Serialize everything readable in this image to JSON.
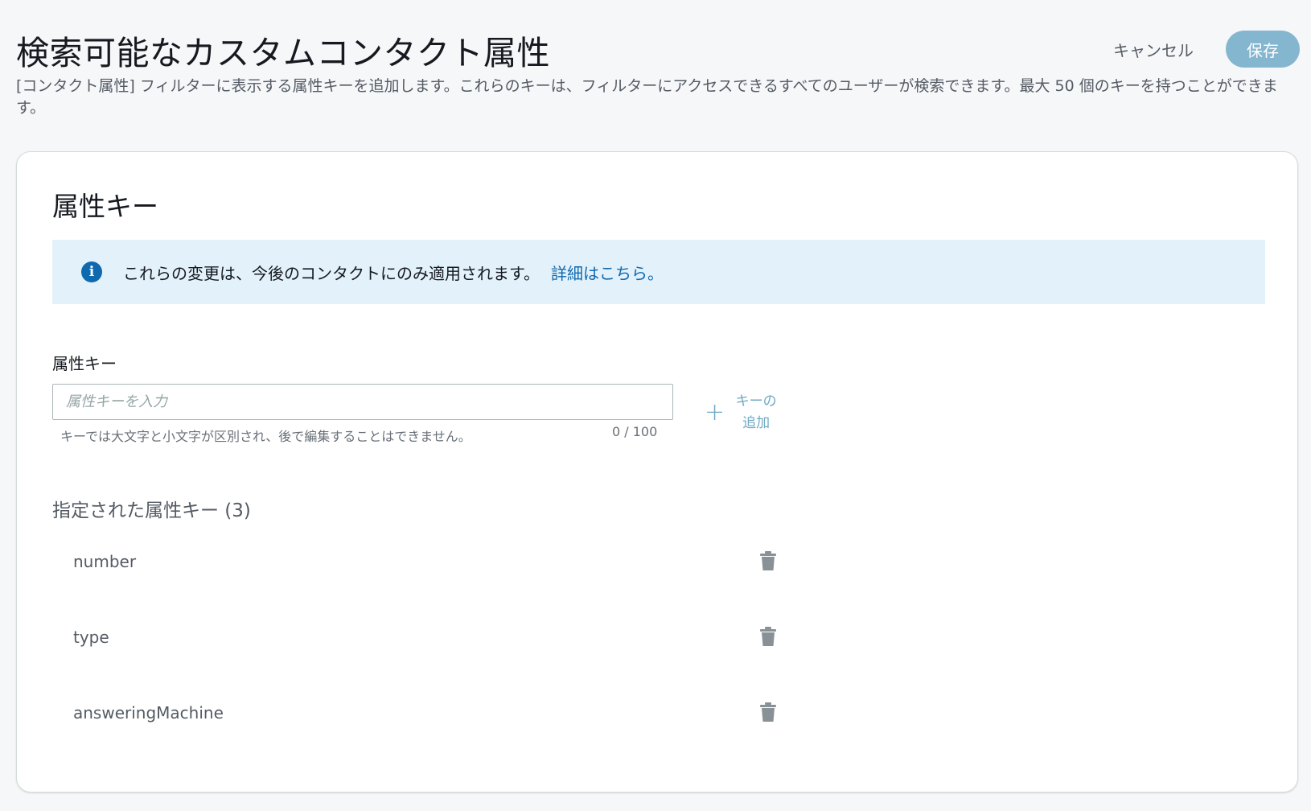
{
  "header": {
    "title": "検索可能なカスタムコンタクト属性",
    "description": "[コンタクト属性] フィルターに表示する属性キーを追加します。これらのキーは、フィルターにアクセスできるすべてのユーザーが検索できます。最大 50 個のキーを持つことができます。",
    "cancel_label": "キャンセル",
    "save_label": "保存"
  },
  "card": {
    "title": "属性キー",
    "info": {
      "text": "これらの変更は、今後のコンタクトにのみ適用されます。",
      "link": "詳細はこちら。",
      "icon": "info-icon"
    },
    "field": {
      "label": "属性キー",
      "placeholder": "属性キーを入力",
      "value": "",
      "hint": "キーでは大文字と小文字が区別され、後で編集することはできません。",
      "count": "0 / 100"
    },
    "add_key": {
      "label_line1": "キーの",
      "label_line2": "追加",
      "icon": "plus-icon"
    },
    "list": {
      "title": "指定された属性キー (3)",
      "items": [
        {
          "name": "number"
        },
        {
          "name": "type"
        },
        {
          "name": "answeringMachine"
        }
      ],
      "delete_icon": "trash-icon"
    }
  },
  "colors": {
    "accent": "#0f69af",
    "save_button": "#84b6cf",
    "banner_bg": "#e3f1fb",
    "add_key": "#6fa9c4"
  }
}
